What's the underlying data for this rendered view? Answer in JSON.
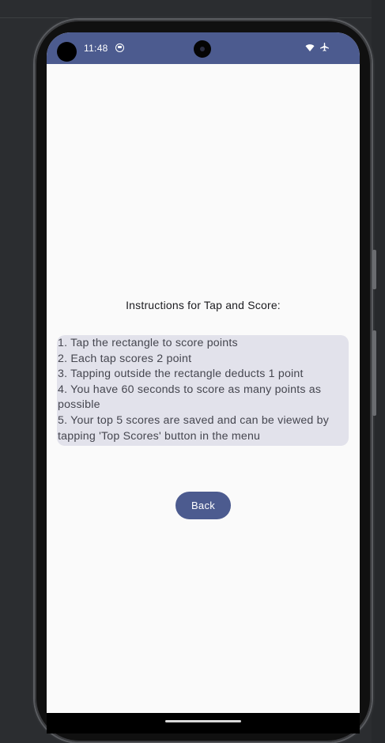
{
  "status_bar": {
    "time": "11:48",
    "icons": [
      "sync-icon",
      "wifi-icon",
      "airplane-mode-icon"
    ]
  },
  "screen": {
    "title": "Instructions for Tap and Score:",
    "instructions": [
      "1. Tap the rectangle to score points",
      "2. Each tap scores 2 point",
      "3. Tapping outside the rectangle deducts 1 point",
      "4. You have 60 seconds to score as many points as",
      "possible",
      "5. Your top 5 scores are saved and can be viewed by",
      "tapping 'Top Scores' button in the menu"
    ],
    "back_label": "Back"
  },
  "colors": {
    "accent": "#4c5b8f",
    "surface": "#fafafa",
    "instruction_box": "#e2e2eb",
    "text_primary": "#1b1b1f",
    "text_secondary": "#45464f"
  }
}
